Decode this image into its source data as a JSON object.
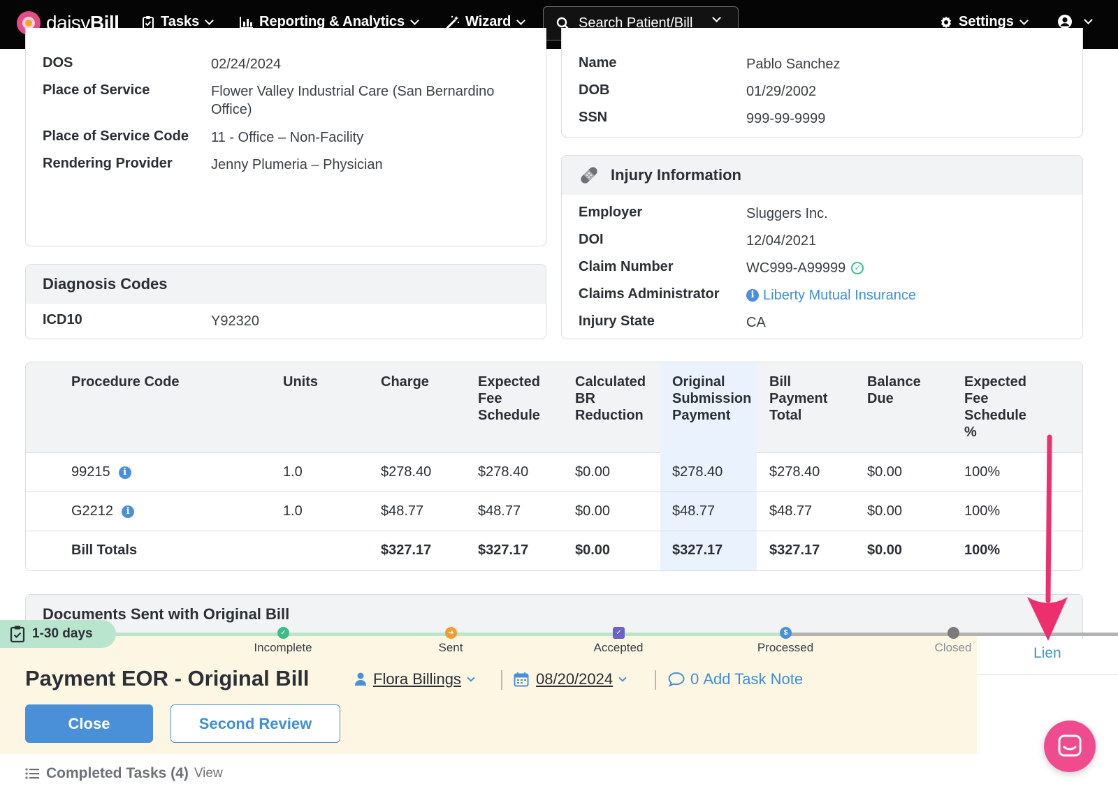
{
  "nav": {
    "brand": "daisyBill",
    "brand_prefix": "daisy",
    "brand_suffix": "Bill",
    "tasks": "Tasks",
    "reporting": "Reporting & Analytics",
    "wizard": "Wizard",
    "search_placeholder": "Search Patient/Bill",
    "settings": "Settings"
  },
  "bill_info": {
    "rows": [
      {
        "label": "DOS",
        "value": "02/24/2024"
      },
      {
        "label": "Place of Service",
        "value": "Flower Valley Industrial Care (San Bernardino Office)"
      },
      {
        "label": "Place of Service Code",
        "value": "11 - Office – Non-Facility"
      },
      {
        "label": "Rendering Provider",
        "value": "Jenny Plumeria – Physician"
      }
    ]
  },
  "patient": {
    "name_label": "Name",
    "name": "Pablo Sanchez",
    "dob_label": "DOB",
    "dob": "01/29/2002",
    "ssn_label": "SSN",
    "ssn": "999-99-9999"
  },
  "diagnosis": {
    "title": "Diagnosis Codes",
    "code_label": "ICD10",
    "code": "Y92320"
  },
  "injury": {
    "title": "Injury Information",
    "employer_label": "Employer",
    "employer": "Sluggers Inc.",
    "doi_label": "DOI",
    "doi": "12/04/2021",
    "claim_label": "Claim Number",
    "claim": "WC999-A99999",
    "admin_label": "Claims Administrator",
    "admin": "Liberty Mutual Insurance",
    "state_label": "Injury State",
    "state": "CA"
  },
  "procedures": {
    "headers": {
      "code": "Procedure Code",
      "units": "Units",
      "charge": "Charge",
      "efs": [
        "Expected",
        "Fee",
        "Schedule"
      ],
      "br": [
        "Calculated",
        "BR",
        "Reduction"
      ],
      "osp": [
        "Original",
        "Submission",
        "Payment"
      ],
      "bpt": [
        "Bill",
        "Payment",
        "Total"
      ],
      "bal": [
        "Balance",
        "Due"
      ],
      "efsp": [
        "Expected",
        "Fee",
        "Schedule",
        "%"
      ]
    },
    "rows": [
      {
        "code": "99215",
        "units": "1.0",
        "charge": "$278.40",
        "efs": "$278.40",
        "br": "$0.00",
        "osp": "$278.40",
        "bpt": "$278.40",
        "bal": "$0.00",
        "efsp": "100%"
      },
      {
        "code": "G2212",
        "units": "1.0",
        "charge": "$48.77",
        "efs": "$48.77",
        "br": "$0.00",
        "osp": "$48.77",
        "bpt": "$48.77",
        "bal": "$0.00",
        "efsp": "100%"
      }
    ],
    "totals": {
      "label": "Bill Totals",
      "charge": "$327.17",
      "efs": "$327.17",
      "br": "$0.00",
      "osp": "$327.17",
      "bpt": "$327.17",
      "bal": "$0.00",
      "efsp": "100%"
    }
  },
  "documents": {
    "title": "Documents Sent with Original Bill"
  },
  "task": {
    "days_badge": "1-30 days",
    "steps": [
      "Incomplete",
      "Sent",
      "Accepted",
      "Processed",
      "Closed"
    ],
    "lien": "Lien",
    "title": "Payment EOR - Original Bill",
    "assignee": "Flora Billings",
    "due_date": "08/20/2024",
    "note_count": "0",
    "note_label": "Add Task Note",
    "close_btn": "Close",
    "review_btn": "Second Review"
  },
  "completed": {
    "label": "Completed Tasks (4)",
    "view": "View"
  },
  "colors": {
    "accent": "#4a90d9",
    "nav_bg": "#050505",
    "task_bg": "#fcf6e2",
    "arrow": "#ee2f6e"
  }
}
